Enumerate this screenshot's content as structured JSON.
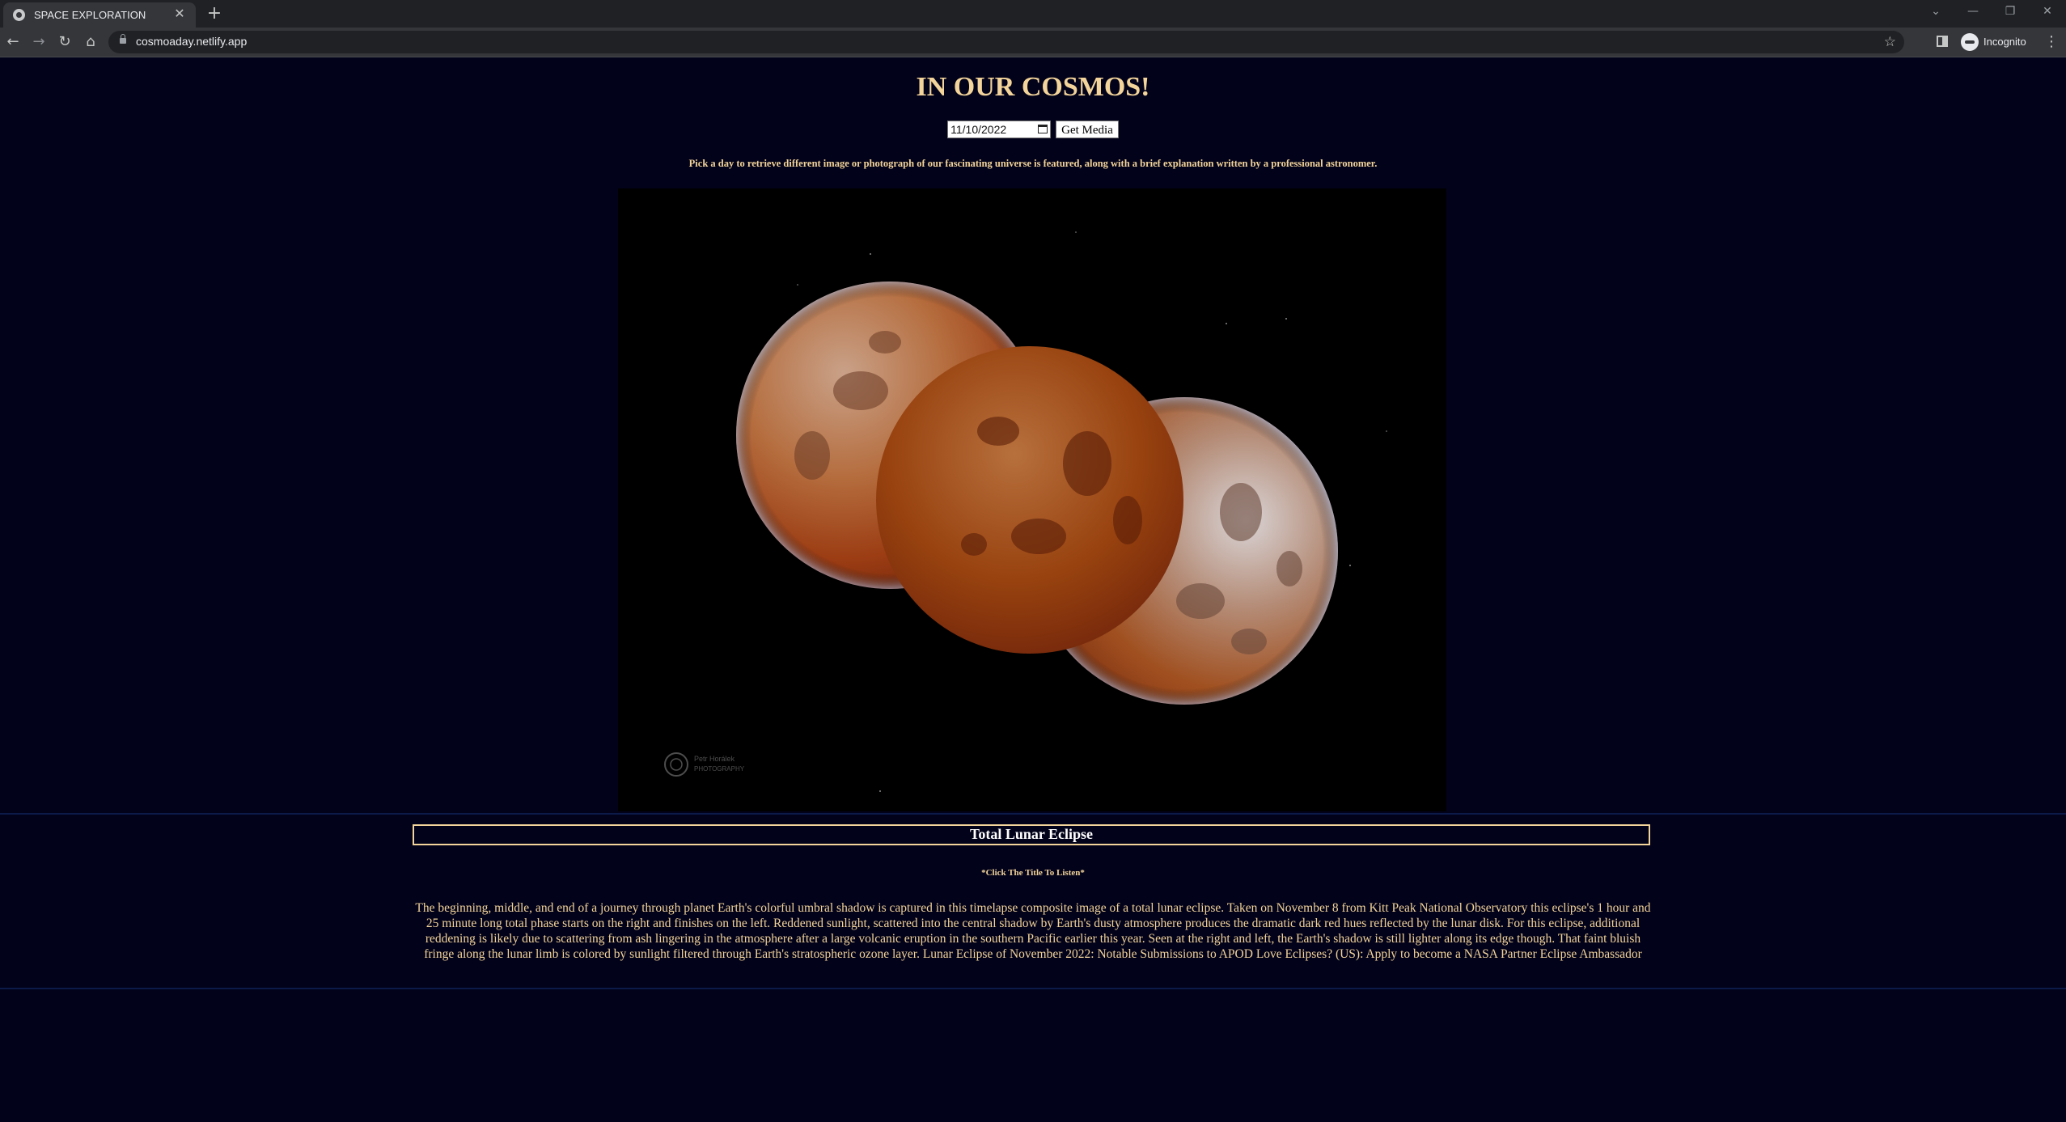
{
  "browser": {
    "tab_title": "SPACE EXPLORATION",
    "tab_close_glyph": "✕",
    "new_tab_glyph": "+",
    "url": "cosmoaday.netlify.app",
    "profile_label": "Incognito",
    "nav_icons": [
      "back-icon",
      "forward-icon",
      "reload-icon",
      "home-icon"
    ],
    "window_controls": [
      "chevron-down-icon",
      "minimize-icon",
      "restore-icon",
      "close-icon"
    ]
  },
  "page": {
    "title": "IN OUR COSMOS!",
    "date_value": "11/10/2022",
    "get_button_label": "Get Media",
    "intro_text": "Pick a day to retrieve different image or photograph of our fascinating universe is featured, along with a brief explanation written by a professional astronomer.",
    "media_watermark": "Petr Horálek PHOTOGRAPHY",
    "apod_title": "Total Lunar Eclipse",
    "listen_hint": "*Click The Title To Listen*",
    "explanation": "The beginning, middle, and end of a journey through planet Earth's colorful umbral shadow is captured in this timelapse composite image of a total lunar eclipse. Taken on November 8 from Kitt Peak National Observatory this eclipse's 1 hour and 25 minute long total phase starts on the right and finishes on the left. Reddened sunlight, scattered into the central shadow by Earth's dusty atmosphere produces the dramatic dark red hues reflected by the lunar disk. For this eclipse, additional reddening is likely due to scattering from ash lingering in the atmosphere after a large volcanic eruption in the southern Pacific earlier this year. Seen at the right and left, the Earth's shadow is still lighter along its edge though. That faint bluish fringe along the lunar limb is colored by sunlight filtered through Earth's stratospheric ozone layer. Lunar Eclipse of November 2022: Notable Submissions to APOD Love Eclipses? (US): Apply to become a NASA Partner Eclipse Ambassador"
  },
  "colors": {
    "page_background": "#02021a",
    "accent_text": "#f3d49a",
    "title_text": "#ffffff",
    "panel_border": "#0c1a4a"
  }
}
